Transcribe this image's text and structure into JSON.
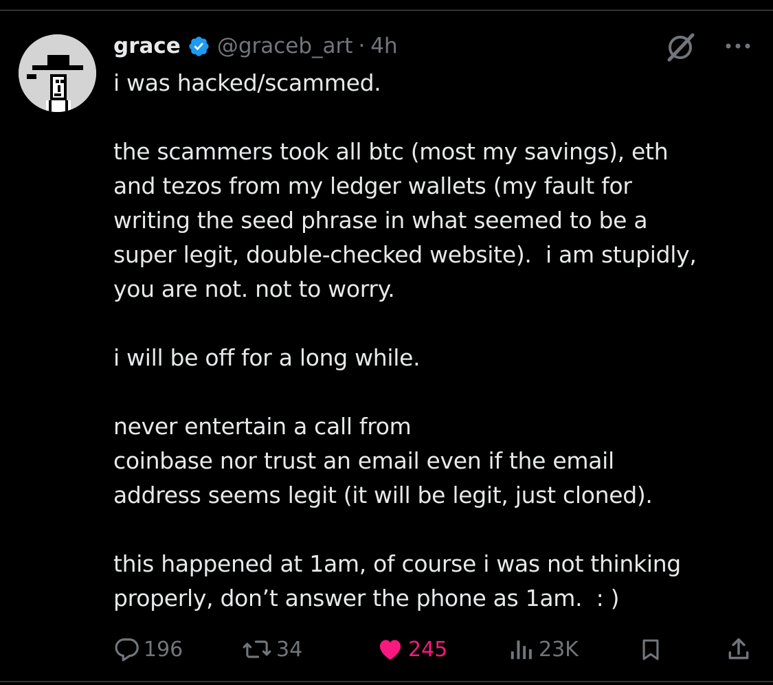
{
  "tweet": {
    "author": {
      "display_name": "grace",
      "handle": "@graceb_art",
      "verified_icon": "verified-badge-icon",
      "separator": "·",
      "timestamp": "4h"
    },
    "body_lines": [
      "i was hacked/scammed.",
      "",
      "the scammers took all btc (most my savings), eth",
      "and tezos from my ledger wallets (my fault for",
      "writing the seed phrase in what seemed to be a",
      "super legit, double-checked website).  i am stupidly,",
      "you are not. not to worry.",
      "",
      "i will be off for a long while.",
      "",
      "never entertain a call from",
      "coinbase nor trust an email even if the email",
      "address seems legit (it will be legit, just cloned).",
      "",
      "this happened at 1am, of course i was not thinking",
      "properly, don’t answer the phone as 1am.  : )"
    ],
    "metrics": {
      "replies": "196",
      "reposts": "34",
      "likes": "245",
      "views": "23K"
    }
  },
  "icons": {
    "reply": "reply-icon",
    "repost": "repost-icon",
    "like": "heart-icon",
    "views": "views-icon",
    "bookmark": "bookmark-icon",
    "share": "share-icon",
    "grok": "grok-icon",
    "more": "more-icon"
  },
  "colors": {
    "background": "#000000",
    "text": "#e7e9ea",
    "secondary": "#71767b",
    "like": "#f91880",
    "verified": "#1d9bf0",
    "divider": "#2f3336"
  }
}
